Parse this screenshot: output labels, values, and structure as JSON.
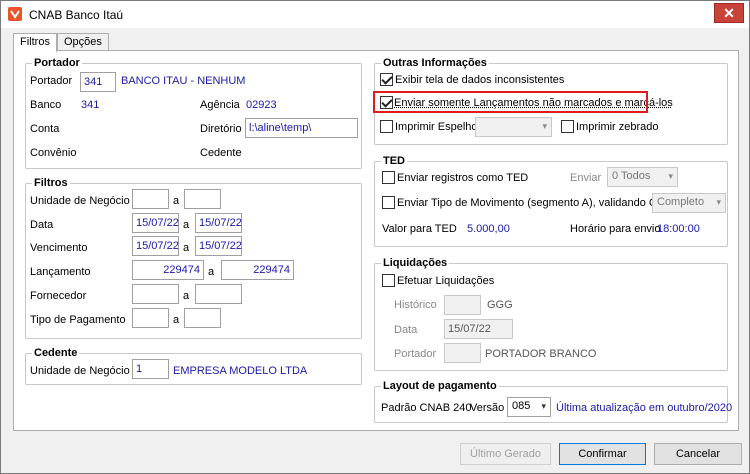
{
  "window": {
    "title": "CNAB Banco Itaú",
    "close": "✕"
  },
  "tabs": [
    {
      "label": "Filtros"
    },
    {
      "label": "Opções"
    }
  ],
  "portador": {
    "legend": "Portador",
    "portador_label": "Portador",
    "portador_code": "341",
    "portador_name": "BANCO ITAU - NENHUM",
    "banco_label": "Banco",
    "banco_value": "341",
    "agencia_label": "Agência",
    "agencia_value": "02923",
    "conta_label": "Conta",
    "diretorio_label": "Diretório",
    "diretorio_value": "l:\\aline\\temp\\",
    "convenio_label": "Convênio",
    "cedente_label": "Cedente"
  },
  "filtros": {
    "legend": "Filtros",
    "a": "a",
    "unidade_label": "Unidade de Negócio",
    "data_label": "Data",
    "data_from": "15/07/22",
    "data_to": "15/07/22",
    "vencimento_label": "Vencimento",
    "venc_from": "15/07/22",
    "venc_to": "15/07/22",
    "lancamento_label": "Lançamento",
    "lanc_from": "229474",
    "lanc_to": "229474",
    "fornecedor_label": "Fornecedor",
    "tipo_pagamento_label": "Tipo de Pagamento"
  },
  "cedente": {
    "legend": "Cedente",
    "unidade_label": "Unidade de Negócio",
    "unidade_code": "1",
    "unidade_name": "EMPRESA MODELO LTDA"
  },
  "outras": {
    "legend": "Outras Informações",
    "exibir_label": "Exibir tela de dados inconsistentes",
    "enviar_somente_label": "Enviar somente Lançamentos não marcados e marcá-los",
    "imprimir_espelho_label": "Imprimir Espelho",
    "imprimir_zebrado_label": "Imprimir zebrado"
  },
  "ted": {
    "legend": "TED",
    "enviar_registros_label": "Enviar registros como TED",
    "enviar_label": "Enviar",
    "enviar_value": "0 Todos",
    "enviar_tipo_label": "Enviar Tipo de Movimento (segmento A), validando CNPJ",
    "tipo_value": "Completo",
    "valor_label": "Valor para TED",
    "valor_value": "5.000,00",
    "horario_label": "Horário para envio",
    "horario_value": "18:00:00"
  },
  "liquidacoes": {
    "legend": "Liquidações",
    "efetuar_label": "Efetuar Liquidações",
    "historico_label": "Histórico",
    "historico_value": "GGG",
    "data_label": "Data",
    "data_value": "15/07/22",
    "portador_label": "Portador",
    "portador_value": "PORTADOR BRANCO"
  },
  "layout": {
    "legend": "Layout de pagamento",
    "padrao_label": "Padrão CNAB 240",
    "versao_label": "Versão",
    "versao_value": "085",
    "ultima_label": "Última atualização em outubro/2020"
  },
  "buttons": {
    "ultimo_gerado": "Último Gerado",
    "confirmar": "Confirmar",
    "cancelar": "Cancelar"
  },
  "colors": {
    "value_blue": "#1a1aa8",
    "highlight_red": "#e01b1b",
    "close_red": "#c8443a"
  }
}
